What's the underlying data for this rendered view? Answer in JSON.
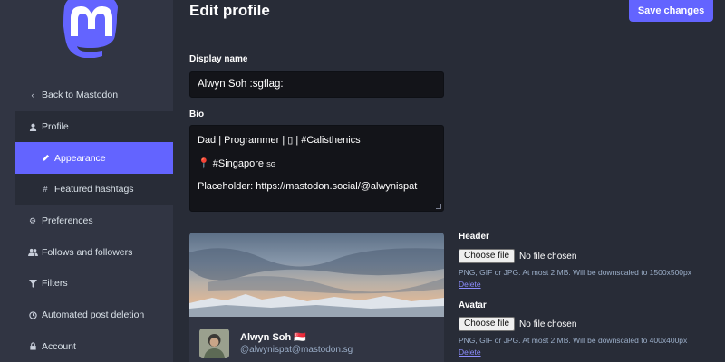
{
  "sidebar": {
    "items": [
      {
        "label": "Back to Mastodon",
        "icon": "chevron-left-icon"
      },
      {
        "label": "Profile",
        "icon": "user-icon"
      },
      {
        "label": "Appearance",
        "icon": "pencil-icon"
      },
      {
        "label": "Featured hashtags",
        "icon": "hashtag-icon"
      },
      {
        "label": "Preferences",
        "icon": "cog-icon"
      },
      {
        "label": "Follows and followers",
        "icon": "users-icon"
      },
      {
        "label": "Filters",
        "icon": "filter-icon"
      },
      {
        "label": "Automated post deletion",
        "icon": "history-icon"
      },
      {
        "label": "Account",
        "icon": "lock-icon"
      }
    ]
  },
  "header": {
    "title": "Edit profile",
    "save_label": "Save changes"
  },
  "form": {
    "display_name_label": "Display name",
    "display_name_value": "Alwyn Soh :sgflag:",
    "bio_label": "Bio",
    "bio_line1": "Dad | Programmer | ▯ | #Calisthenics",
    "bio_line2_icon": "📍",
    "bio_line2": "#Singapore",
    "bio_line2_suffix": "SG",
    "bio_line3": "Placeholder: https://mastodon.social/@alwynispat"
  },
  "preview": {
    "display_name": "Alwyn Soh 🇸🇬",
    "handle": "@alwynispat@mastodon.sg"
  },
  "header_upload": {
    "label": "Header",
    "button": "Choose file",
    "status": "No file chosen",
    "hint": "PNG, GIF or JPG. At most 2 MB. Will be downscaled to 1500x500px",
    "delete": "Delete"
  },
  "avatar_upload": {
    "label": "Avatar",
    "button": "Choose file",
    "status": "No file chosen",
    "hint": "PNG, GIF or JPG. At most 2 MB. Will be downscaled to 400x400px",
    "delete": "Delete"
  },
  "colors": {
    "accent": "#6364ff",
    "background": "#282c37",
    "sidebar": "#313543",
    "input": "#131419"
  }
}
